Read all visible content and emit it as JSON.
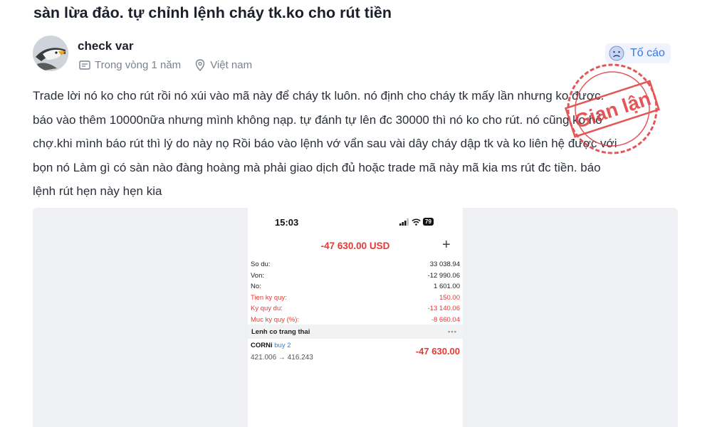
{
  "post": {
    "title": "sàn lừa đảo. tự chỉnh lệnh cháy tk.ko cho rút tiền",
    "author": "check var",
    "time": "Trong vòng 1 năm",
    "location": "Việt nam",
    "report_label": "Tố cáo",
    "body_lines": [
      "Trade lời nó ko cho rút rồi nó xúi vào mã này để cháy tk luôn. nó định cho cháy tk mấy lần nhưng ko được.",
      "báo vào thêm 10000nữa nhưng mình không nạp. tự đánh tự lên đc 30000 thì nó ko cho rút. nó cũng ko hỗ",
      "chợ.khi mình báo rút thì lý do này nọ Rồi báo vào lệnh vớ vẩn sau vài dây cháy dập tk và ko liên hệ được với",
      "bọn nó Làm gì có sàn nào đàng hoàng mà phải giao dịch đủ hoặc trade mã này mã kia ms rút đc tiền. báo",
      "lệnh rút hẹn này hẹn kia"
    ],
    "stamp_text": "Gian lận",
    "stamp_color": "#e0383c"
  },
  "screenshot": {
    "time": "15:03",
    "battery": "79",
    "balance": "-47 630.00 USD",
    "add_icon": "plus-icon",
    "rows": [
      {
        "label": "So du:",
        "value": "33 038.94",
        "color": "black"
      },
      {
        "label": "Von:",
        "value": "-12 990.06",
        "color": "black"
      },
      {
        "label": "No:",
        "value": "1 601.00",
        "color": "black"
      },
      {
        "label": "Tien ky quy:",
        "value": "150.00",
        "color": "red"
      },
      {
        "label": "Ky quy du:",
        "value": "-13 140.06",
        "color": "red"
      },
      {
        "label": "Muc ky quy (%):",
        "value": "-8 660.04",
        "color": "red"
      }
    ],
    "positions_header": "Lenh co trang thai",
    "positions_more": "•••",
    "position": {
      "symbol": "CORNi",
      "side": "buy 2",
      "prices": "421.006 → 416.243",
      "profit": "-47 630.00"
    }
  },
  "colors": {
    "accent_blue": "#3d78d8",
    "loss_red": "#e53935"
  }
}
